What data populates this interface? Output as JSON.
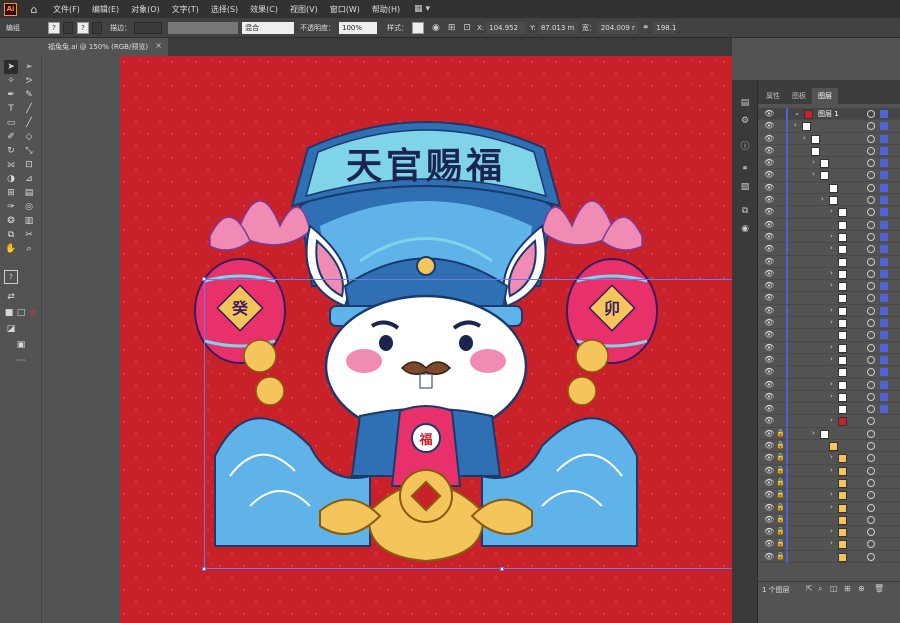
{
  "app": {
    "logo": "Ai"
  },
  "menu": [
    "文件(F)",
    "编辑(E)",
    "对象(O)",
    "文字(T)",
    "选择(S)",
    "效果(C)",
    "视图(V)",
    "窗口(W)",
    "帮助(H)"
  ],
  "control": {
    "mode": "编组",
    "stroke_label": "描边：",
    "blend": "混合",
    "opacity_label": "不透明度：",
    "opacity": "100%",
    "style_label": "样式：",
    "x_label": "X:",
    "x": "104.952",
    "y_label": "Y:",
    "y": "87.013 m",
    "w_label": "宽：",
    "w": "204.009 r",
    "h": "198.1"
  },
  "document": {
    "tab_title": "福兔兔.ai @ 150% (RGB/预览)"
  },
  "artwork": {
    "banner": "天官赐福",
    "left_badge": "癸",
    "right_badge": "卯",
    "bag_char": "福",
    "colors": {
      "background": "#c8212a",
      "banner": "#7fd4e8",
      "wave": "#5fb3e8",
      "gold": "#f3c55a",
      "pink": "#f08bb4"
    }
  },
  "panel": {
    "tabs": [
      "属性",
      "图板",
      "图层"
    ],
    "active_tab": "图层",
    "top_layer": "图层 1",
    "footer_count": "1 个图层"
  }
}
